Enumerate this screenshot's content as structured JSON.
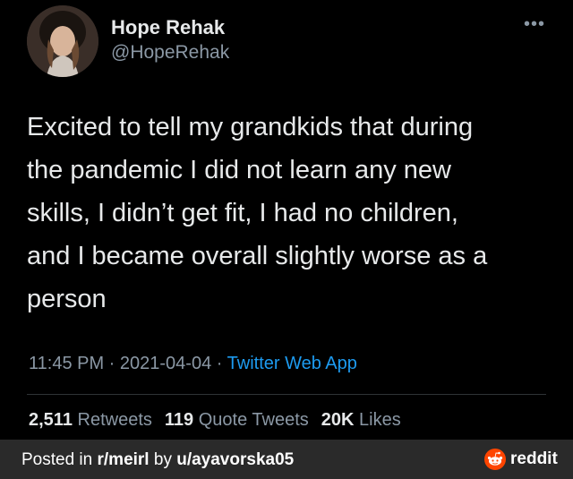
{
  "tweet": {
    "author_name": "Hope Rehak",
    "handle": "@HopeRehak",
    "more_icon": "more-horizontal-icon",
    "text": "Excited to tell my grandkids that during\nthe pandemic I did not learn any new\nskills, I didn’t get fit, I had no children,\nand I became overall slightly worse as a\nperson",
    "time": "11:45 PM",
    "sep1": " · ",
    "date": "2021-04-04",
    "sep2": " · ",
    "source": "Twitter Web App",
    "retweets_count": "2,511",
    "retweets_label": "Retweets",
    "quotes_count": "119",
    "quotes_label": "Quote Tweets",
    "likes_count": "20K",
    "likes_label": "Likes"
  },
  "footer": {
    "prefix": "Posted in ",
    "subreddit": "r/meirl",
    "by": " by ",
    "user": "u/ayavorska05",
    "brand": "reddit"
  },
  "colors": {
    "background": "#000000",
    "text": "#e7e9ea",
    "muted": "#8b98a5",
    "link": "#1d9bf0",
    "reddit_orange": "#ff4500"
  }
}
